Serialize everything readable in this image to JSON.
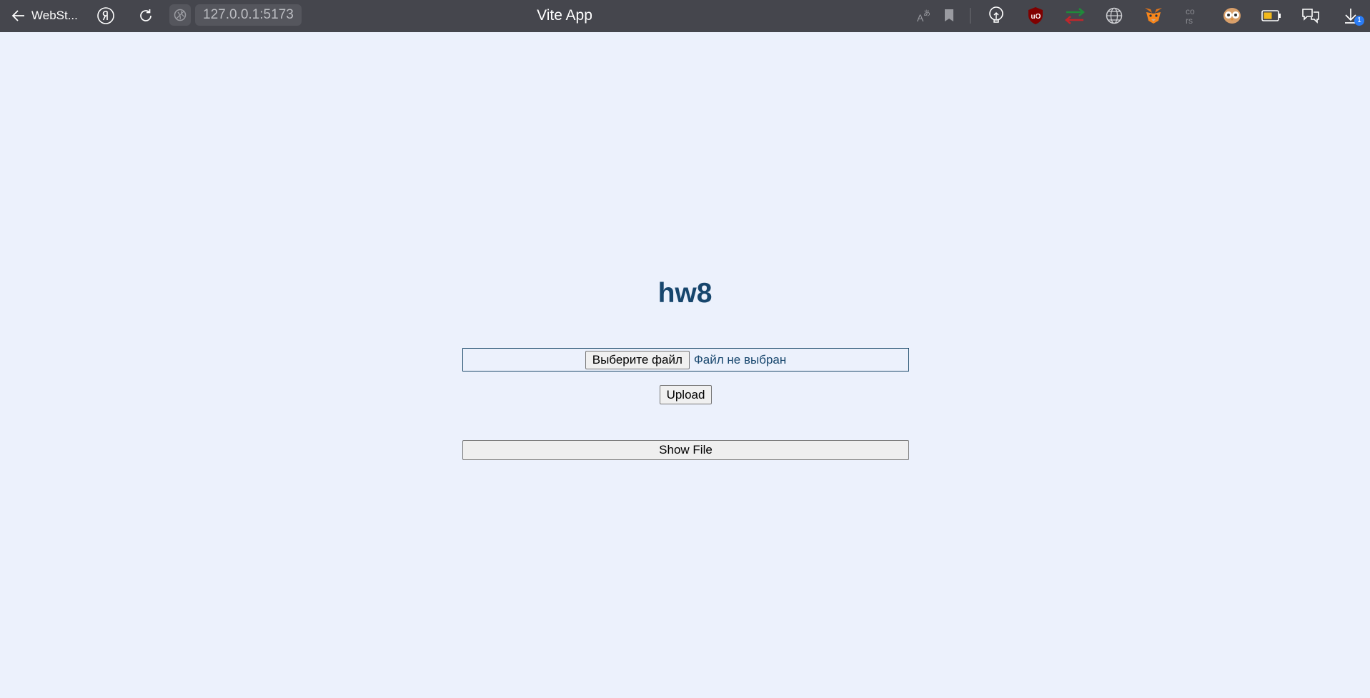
{
  "browser": {
    "back_label": "WebSt...",
    "url": "127.0.0.1:5173",
    "tab_title": "Vite App",
    "download_count": "1",
    "icons": [
      "back-arrow-icon",
      "yandex-icon",
      "reload-icon",
      "site-shield-icon",
      "translate-icon",
      "bookmark-icon",
      "lightbulb-icon",
      "ublock-icon",
      "extension-arrows-icon",
      "globe-icon",
      "metamask-fox-icon",
      "cors-icon",
      "owl-icon",
      "battery-icon",
      "chat-bubbles-icon",
      "download-icon"
    ]
  },
  "page": {
    "title": "hw8",
    "choose_file_label": "Выберите файл",
    "file_status": "Файл не выбран",
    "upload_label": "Upload",
    "show_file_label": "Show File"
  },
  "colors": {
    "page_background": "#ecf1fc",
    "topbar_background": "#45464d",
    "heading_color": "#17466d",
    "badge_blue": "#2a7cf6"
  }
}
